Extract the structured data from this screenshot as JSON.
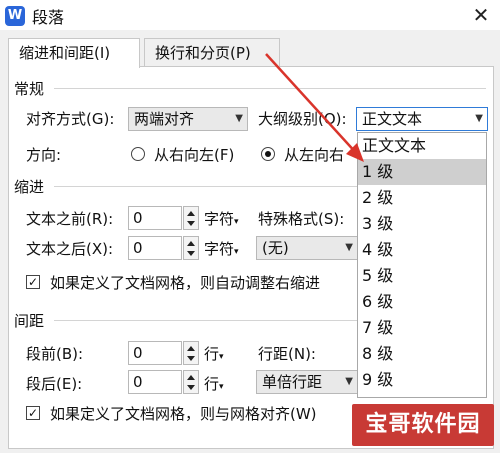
{
  "window": {
    "title": "段落",
    "app_icon": "W",
    "close": "✕"
  },
  "tabs": [
    {
      "label": "缩进和间距(I)",
      "active": true
    },
    {
      "label": "换行和分页(P)",
      "active": false
    }
  ],
  "general": {
    "section": "常规",
    "alignment_label": "对齐方式(G):",
    "alignment_value": "两端对齐",
    "outline_label": "大纲级别(O):",
    "outline_value": "正文文本",
    "direction_label": "方向:",
    "rtl_label": "从右向左(F)",
    "ltr_label": "从左向右"
  },
  "indent": {
    "section": "缩进",
    "before_label": "文本之前(R):",
    "before_value": "0",
    "before_unit": "字符",
    "after_label": "文本之后(X):",
    "after_value": "0",
    "after_unit": "字符",
    "special_label": "特殊格式(S):",
    "special_value": "(无)",
    "grid_check_label": "如果定义了文档网格，则自动调整右缩进"
  },
  "spacing": {
    "section": "间距",
    "before_label": "段前(B):",
    "before_value": "0",
    "before_unit": "行",
    "after_label": "段后(E):",
    "after_value": "0",
    "after_unit": "行",
    "line_label": "行距(N):",
    "line_value": "单倍行距",
    "grid_check_label": "如果定义了文档网格，则与网格对齐(W)"
  },
  "outline_dropdown": {
    "options": [
      "正文文本",
      "1 级",
      "2 级",
      "3 级",
      "4 级",
      "5 级",
      "6 级",
      "7 级",
      "8 级",
      "9 级"
    ],
    "highlighted": "1 级"
  },
  "watermark": "宝哥软件园",
  "colors": {
    "accent": "#2f7bd8",
    "arrow": "#d9342b",
    "watermark_bg": "#c83a35"
  }
}
